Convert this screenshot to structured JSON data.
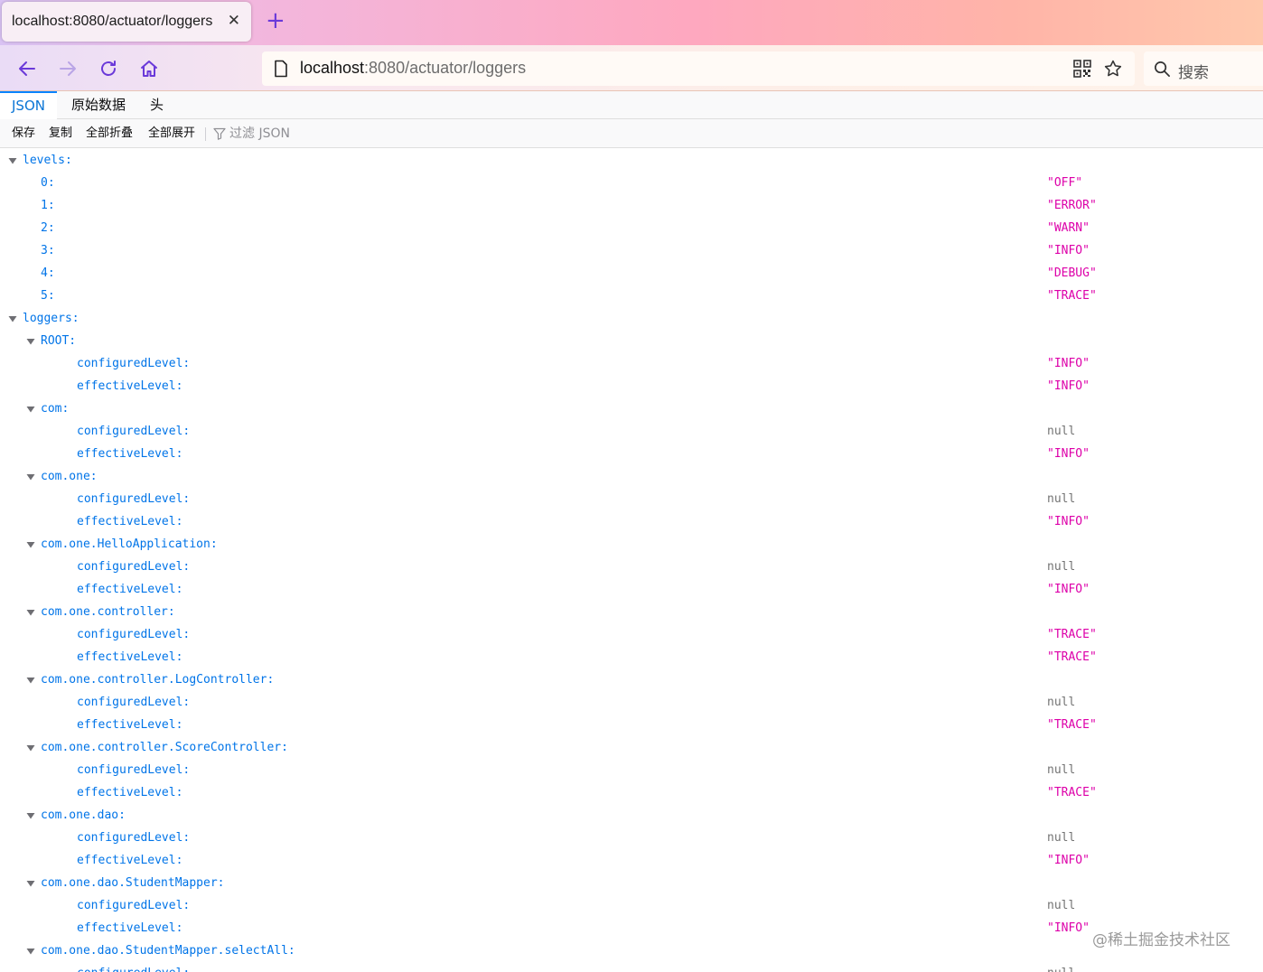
{
  "browser": {
    "tab_title": "localhost:8080/actuator/loggers",
    "url_host": "localhost",
    "url_rest": ":8080/actuator/loggers",
    "search_placeholder": "搜索",
    "accent_color": "#6a39d9"
  },
  "viewer": {
    "tabs": [
      "JSON",
      "原始数据",
      "头"
    ],
    "active_tab": "JSON",
    "toolbar": {
      "save": "保存",
      "copy": "复制",
      "collapse_all": "全部折叠",
      "expand_all": "全部展开",
      "filter_placeholder": "过滤 JSON"
    }
  },
  "json_tree": [
    {
      "depth": 0,
      "key": "levels:",
      "expandable": true
    },
    {
      "depth": 1,
      "key": "0:",
      "value": "\"OFF\"",
      "type": "string"
    },
    {
      "depth": 1,
      "key": "1:",
      "value": "\"ERROR\"",
      "type": "string"
    },
    {
      "depth": 1,
      "key": "2:",
      "value": "\"WARN\"",
      "type": "string"
    },
    {
      "depth": 1,
      "key": "3:",
      "value": "\"INFO\"",
      "type": "string"
    },
    {
      "depth": 1,
      "key": "4:",
      "value": "\"DEBUG\"",
      "type": "string"
    },
    {
      "depth": 1,
      "key": "5:",
      "value": "\"TRACE\"",
      "type": "string"
    },
    {
      "depth": 0,
      "key": "loggers:",
      "expandable": true
    },
    {
      "depth": 1,
      "key": "ROOT:",
      "expandable": true
    },
    {
      "depth": 2,
      "key": "configuredLevel:",
      "value": "\"INFO\"",
      "type": "string"
    },
    {
      "depth": 2,
      "key": "effectiveLevel:",
      "value": "\"INFO\"",
      "type": "string"
    },
    {
      "depth": 1,
      "key": "com:",
      "expandable": true
    },
    {
      "depth": 2,
      "key": "configuredLevel:",
      "value": "null",
      "type": "null"
    },
    {
      "depth": 2,
      "key": "effectiveLevel:",
      "value": "\"INFO\"",
      "type": "string"
    },
    {
      "depth": 1,
      "key": "com.one:",
      "expandable": true
    },
    {
      "depth": 2,
      "key": "configuredLevel:",
      "value": "null",
      "type": "null"
    },
    {
      "depth": 2,
      "key": "effectiveLevel:",
      "value": "\"INFO\"",
      "type": "string"
    },
    {
      "depth": 1,
      "key": "com.one.HelloApplication:",
      "expandable": true
    },
    {
      "depth": 2,
      "key": "configuredLevel:",
      "value": "null",
      "type": "null"
    },
    {
      "depth": 2,
      "key": "effectiveLevel:",
      "value": "\"INFO\"",
      "type": "string"
    },
    {
      "depth": 1,
      "key": "com.one.controller:",
      "expandable": true
    },
    {
      "depth": 2,
      "key": "configuredLevel:",
      "value": "\"TRACE\"",
      "type": "string"
    },
    {
      "depth": 2,
      "key": "effectiveLevel:",
      "value": "\"TRACE\"",
      "type": "string"
    },
    {
      "depth": 1,
      "key": "com.one.controller.LogController:",
      "expandable": true
    },
    {
      "depth": 2,
      "key": "configuredLevel:",
      "value": "null",
      "type": "null"
    },
    {
      "depth": 2,
      "key": "effectiveLevel:",
      "value": "\"TRACE\"",
      "type": "string"
    },
    {
      "depth": 1,
      "key": "com.one.controller.ScoreController:",
      "expandable": true
    },
    {
      "depth": 2,
      "key": "configuredLevel:",
      "value": "null",
      "type": "null"
    },
    {
      "depth": 2,
      "key": "effectiveLevel:",
      "value": "\"TRACE\"",
      "type": "string"
    },
    {
      "depth": 1,
      "key": "com.one.dao:",
      "expandable": true
    },
    {
      "depth": 2,
      "key": "configuredLevel:",
      "value": "null",
      "type": "null"
    },
    {
      "depth": 2,
      "key": "effectiveLevel:",
      "value": "\"INFO\"",
      "type": "string"
    },
    {
      "depth": 1,
      "key": "com.one.dao.StudentMapper:",
      "expandable": true
    },
    {
      "depth": 2,
      "key": "configuredLevel:",
      "value": "null",
      "type": "null"
    },
    {
      "depth": 2,
      "key": "effectiveLevel:",
      "value": "\"INFO\"",
      "type": "string"
    },
    {
      "depth": 1,
      "key": "com.one.dao.StudentMapper.selectAll:",
      "expandable": true
    },
    {
      "depth": 2,
      "key": "configuredLevel:",
      "value": "null",
      "type": "null"
    }
  ],
  "watermark": "@稀土掘金技术社区"
}
